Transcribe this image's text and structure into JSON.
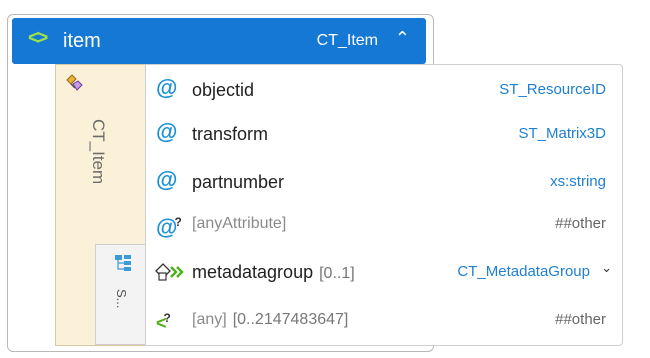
{
  "element": {
    "name": "item",
    "type": "CT_Item",
    "complex_type_label": "CT_Item",
    "sequence_label": "S..."
  },
  "attributes": [
    {
      "name": "objectid",
      "type": "ST_ResourceID"
    },
    {
      "name": "transform",
      "type": "ST_Matrix3D"
    },
    {
      "name": "partnumber",
      "type": "xs:string"
    },
    {
      "name": "[anyAttribute]",
      "type": "##other"
    }
  ],
  "children": [
    {
      "name": "metadatagroup",
      "occurs": "[0..1]",
      "type": "CT_MetadataGroup"
    },
    {
      "name": "[any]",
      "occurs": "[0..2147483647]",
      "type": "##other"
    }
  ],
  "icons": {
    "element": "element-tag-icon",
    "attribute": "at-sign-icon",
    "collapse": "chevron-double-up-icon",
    "expand": "chevron-double-down-icon"
  },
  "colors": {
    "header_bg": "#1478d4",
    "side_panel_bg": "#fbf1d8",
    "type_link": "#1f7fd0"
  }
}
